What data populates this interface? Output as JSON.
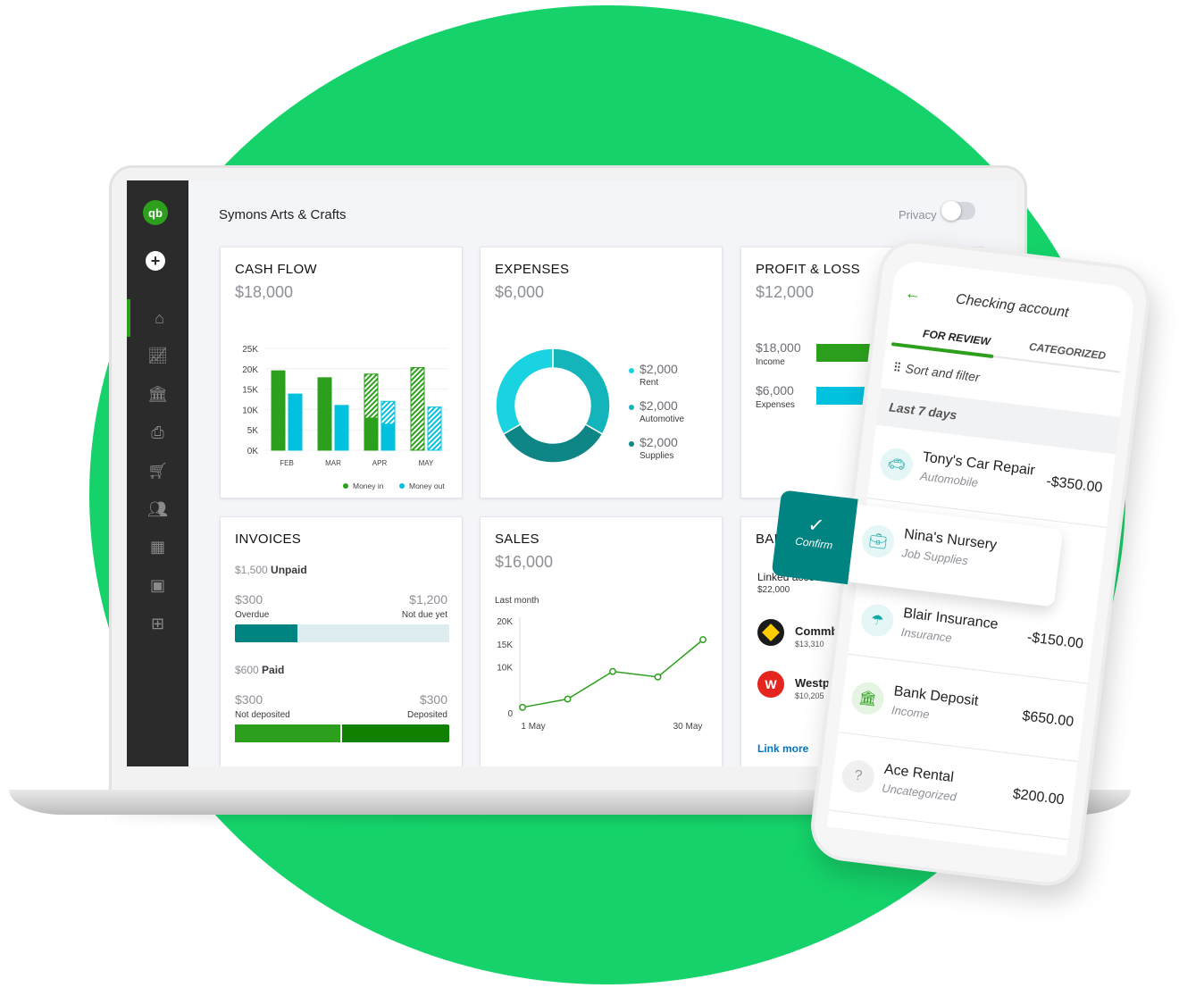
{
  "company": "Symons Arts & Crafts",
  "privacy_label": "Privacy",
  "colors": {
    "brand": "#2ca01c",
    "background_circle": "#15d36a",
    "money_in": "#2ca01c",
    "money_out": "#00c1de",
    "teal": "#008481"
  },
  "sidebar": {
    "logo": "qb",
    "items": [
      {
        "icon": "home-icon"
      },
      {
        "icon": "chart-icon"
      },
      {
        "icon": "bank-icon"
      },
      {
        "icon": "receipt-icon"
      },
      {
        "icon": "cart-icon"
      },
      {
        "icon": "users-icon"
      },
      {
        "icon": "calculator-icon"
      },
      {
        "icon": "tax-icon"
      },
      {
        "icon": "apps-icon"
      }
    ]
  },
  "cash_flow": {
    "title": "CASH FLOW",
    "value": "$18,000"
  },
  "expenses": {
    "title": "EXPENSES",
    "value": "$6,000",
    "legend": [
      {
        "amount": "$2,000",
        "label": "Rent",
        "color": "#1ad3e0"
      },
      {
        "amount": "$2,000",
        "label": "Automotive",
        "color": "#13b5bb"
      },
      {
        "amount": "$2,000",
        "label": "Supplies",
        "color": "#0e8686"
      }
    ]
  },
  "profit_loss": {
    "title": "PROFIT & LOSS",
    "value": "$12,000",
    "income_amount": "$18,000",
    "income_label": "Income",
    "expenses_amount": "$6,000",
    "expenses_label": "Expenses"
  },
  "invoices": {
    "title": "INVOICES",
    "unpaid_amount": "$1,500",
    "unpaid_label": "Unpaid",
    "overdue_amount": "$300",
    "overdue_label": "Overdue",
    "not_due_amount": "$1,200",
    "not_due_label": "Not due yet",
    "overdue_fraction": 0.2,
    "paid_amount": "$600",
    "paid_label": "Paid",
    "not_deposited_amount": "$300",
    "not_deposited_label": "Not deposited",
    "deposited_amount": "$300",
    "deposited_label": "Deposited",
    "not_deposited_fraction": 0.5
  },
  "sales": {
    "title": "SALES",
    "value": "$16,000",
    "period": "Last month"
  },
  "bank": {
    "title": "BANK AC",
    "linked_label": "Linked accounts",
    "linked_amount": "$22,000",
    "accounts": [
      {
        "name": "Commb",
        "amount": "$13,310"
      },
      {
        "name": "Westp",
        "amount": "$10,205"
      }
    ],
    "link_more": "Link more"
  },
  "chart_data": [
    {
      "type": "bar",
      "categories": [
        "FEB",
        "MAR",
        "APR",
        "MAY"
      ],
      "yticks": [
        "0K",
        "5K",
        "10K",
        "15K",
        "20K",
        "25K"
      ],
      "ylim": [
        0,
        25000
      ],
      "series": [
        {
          "name": "Money in",
          "values": [
            19500,
            17800,
            18700,
            20300
          ],
          "actual": [
            19500,
            17800,
            8000,
            0
          ]
        },
        {
          "name": "Money out",
          "values": [
            13800,
            11000,
            12000,
            10600
          ],
          "actual": [
            13800,
            11000,
            6500,
            0
          ]
        }
      ]
    },
    {
      "type": "pie",
      "donut": true,
      "labels": [
        "Rent",
        "Automotive",
        "Supplies"
      ],
      "values": [
        2000,
        2000,
        2000
      ]
    },
    {
      "type": "line",
      "x": [
        "1 May",
        "",
        "",
        "",
        "30 May"
      ],
      "xticks": [
        "1 May",
        "30 May"
      ],
      "yticks": [
        "0",
        "10K",
        "15K",
        "20K"
      ],
      "ylim": [
        0,
        20000
      ],
      "values": [
        1200,
        3000,
        9000,
        7800,
        15900
      ]
    }
  ],
  "phone": {
    "title": "Checking account",
    "tabs": [
      "FOR REVIEW",
      "CATEGORIZED"
    ],
    "sort_label": "Sort and filter",
    "section": "Last 7 days",
    "confirm_label": "Confirm",
    "transactions": [
      {
        "name": "Tony's Car Repair",
        "category": "Automobile",
        "amount": "-$350.00",
        "icon": "car-icon"
      },
      {
        "name": "Nina's Nursery",
        "category": "Job Supplies",
        "amount": "",
        "icon": "briefcase-icon"
      },
      {
        "name": "Blair Insurance",
        "category": "Insurance",
        "amount": "-$150.00",
        "icon": "umbrella-icon"
      },
      {
        "name": "Bank Deposit",
        "category": "Income",
        "amount": "$650.00",
        "icon": "bank-icon"
      },
      {
        "name": "Ace Rental",
        "category": "Uncategorized",
        "amount": "$200.00",
        "icon": "question-icon"
      }
    ]
  }
}
